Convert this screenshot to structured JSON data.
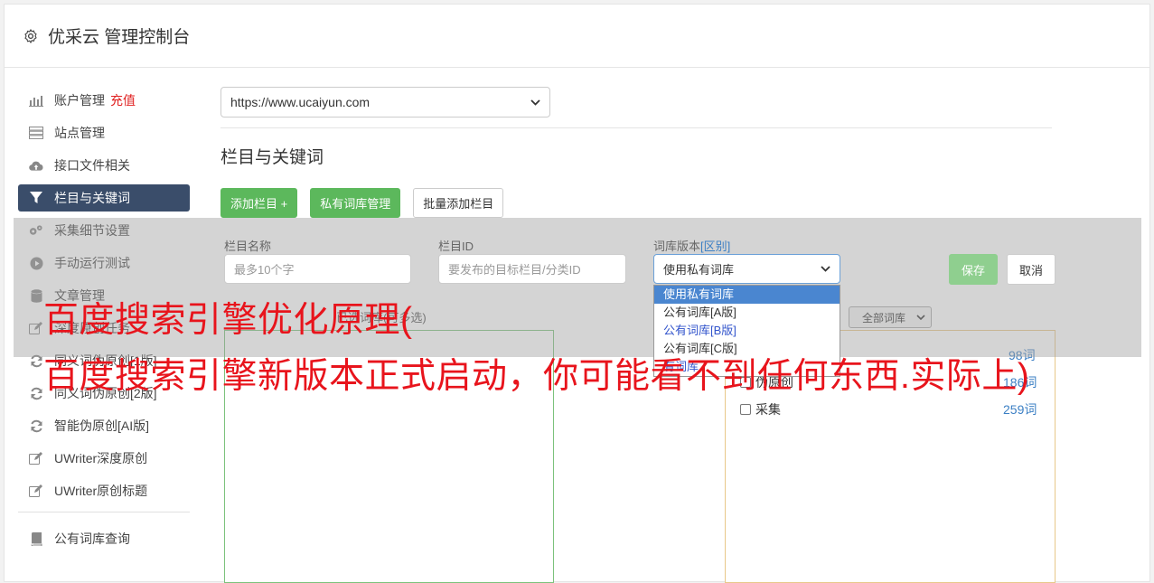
{
  "app": {
    "title": "优采云 管理控制台"
  },
  "sidebar": {
    "items": [
      {
        "label": "账户管理",
        "tag": "充值",
        "icon": "bar-chart-icon"
      },
      {
        "label": "站点管理",
        "icon": "server-icon"
      },
      {
        "label": "接口文件相关",
        "icon": "cloud-upload-icon"
      },
      {
        "label": "栏目与关键词",
        "icon": "filter-icon",
        "active": true
      },
      {
        "label": "采集细节设置",
        "icon": "gears-icon"
      },
      {
        "label": "手动运行测试",
        "icon": "play-circle-icon"
      },
      {
        "label": "文章管理",
        "icon": "database-icon"
      },
      {
        "label": "深度原创任务",
        "icon": "edit-icon"
      },
      {
        "label": "同义词伪原创[1版]",
        "icon": "refresh-icon"
      },
      {
        "label": "同义词伪原创[2版]",
        "icon": "refresh-icon"
      },
      {
        "label": "智能伪原创[AI版]",
        "icon": "refresh-icon"
      },
      {
        "label": "UWriter深度原创",
        "icon": "edit-icon"
      },
      {
        "label": "UWriter原创标题",
        "icon": "edit-icon"
      }
    ],
    "bottom_items": [
      {
        "label": "公有词库查询",
        "icon": "book-icon"
      }
    ]
  },
  "main": {
    "site_select": "https://www.ucaiyun.com",
    "section_title": "栏目与关键词",
    "buttons": {
      "add_column": "添加栏目 +",
      "private_lib": "私有词库管理",
      "batch_add": "批量添加栏目"
    },
    "form": {
      "name_label": "栏目名称",
      "name_placeholder": "最多10个字",
      "id_label": "栏目ID",
      "id_placeholder": "要发布的目标栏目/分类ID",
      "lib_label": "词库版本",
      "lib_label_link": "[区别]",
      "lib_selected": "使用私有词库",
      "lib_options": [
        "使用私有词库",
        "公有词库[A版]",
        "公有词库[B版]",
        "公有词库[C版]",
        "有词库"
      ],
      "save": "保存",
      "cancel": "取消"
    },
    "chosen_label": "已选词库(可多选)",
    "filter_select": "全部词库",
    "libraries": [
      {
        "name": "伪原创",
        "count": "186词"
      },
      {
        "name": "采集",
        "count": "259词"
      }
    ],
    "top_count": "98词"
  },
  "watermark": {
    "line1": "百度搜索引擎优化原理(",
    "line2": "百度搜索引擎新版本正式启动，你可能看不到任何东西.实际上)"
  }
}
